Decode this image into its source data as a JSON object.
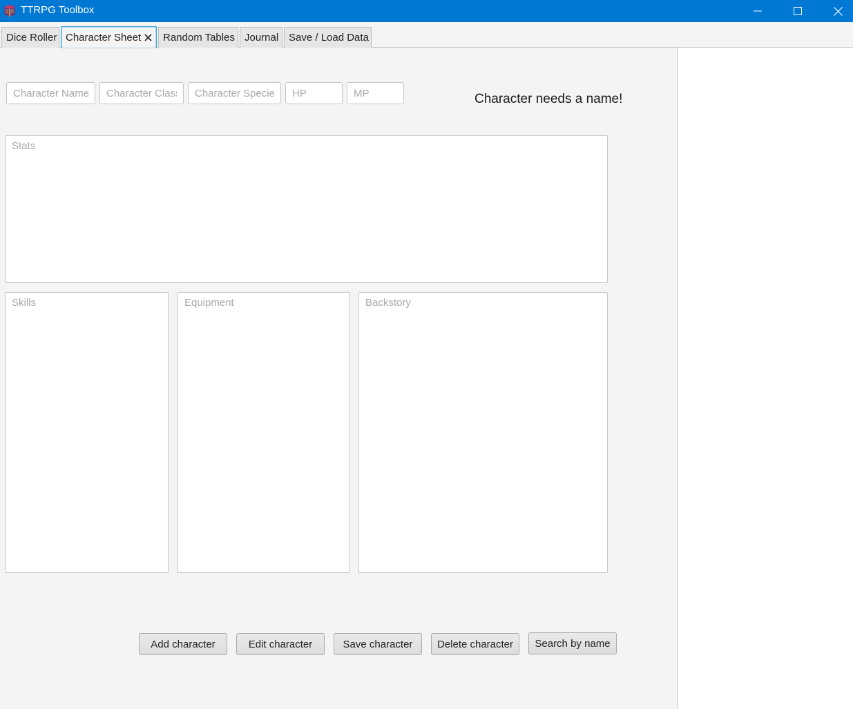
{
  "window": {
    "title": "TTRPG Toolbox",
    "icon": "app-book-icon"
  },
  "tabs": [
    {
      "label": "Dice Roller",
      "active": false
    },
    {
      "label": "Character Sheet",
      "active": true,
      "closable": true
    },
    {
      "label": "Random Tables",
      "active": false
    },
    {
      "label": "Journal",
      "active": false
    },
    {
      "label": "Save / Load Data",
      "active": false
    }
  ],
  "form": {
    "name": {
      "placeholder": "Character Name",
      "value": ""
    },
    "class": {
      "placeholder": "Character Class",
      "value": ""
    },
    "species": {
      "placeholder": "Character Species",
      "value": ""
    },
    "hp": {
      "placeholder": "HP",
      "value": ""
    },
    "mp": {
      "placeholder": "MP",
      "value": ""
    },
    "status_message": "Character needs a name!"
  },
  "areas": {
    "stats": {
      "placeholder": "Stats"
    },
    "skills": {
      "placeholder": "Skills"
    },
    "equipment": {
      "placeholder": "Equipment"
    },
    "backstory": {
      "placeholder": "Backstory"
    }
  },
  "buttons": {
    "add": "Add character",
    "edit": "Edit character",
    "save": "Save character",
    "delete": "Delete character",
    "search": "Search by name"
  },
  "colors": {
    "titlebar": "#0078d4",
    "active_tab_border": "#3ba2e0"
  }
}
